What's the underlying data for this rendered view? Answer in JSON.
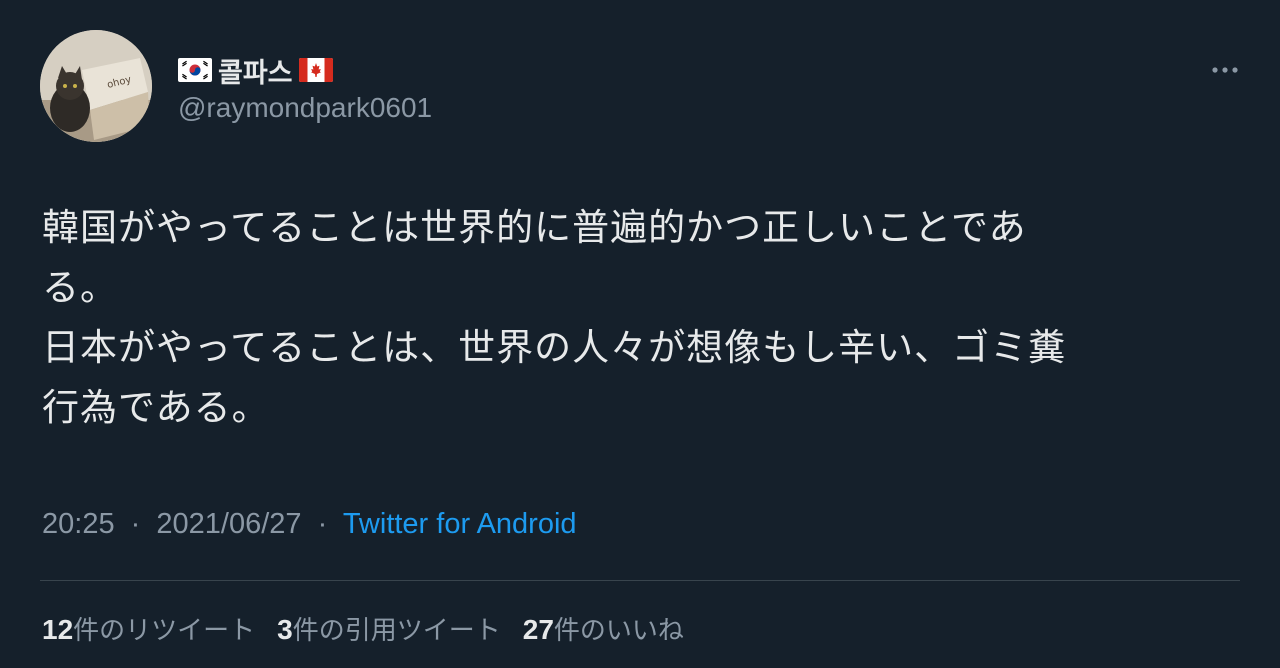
{
  "user": {
    "name": "콜파스",
    "handle": "@raymondpark0601",
    "avatar_icon": "avatar-cat-in-box",
    "flags": [
      "kr-flag-icon",
      "ca-flag-icon"
    ]
  },
  "tweet": {
    "lines": [
      "韓国がやってることは世界的に普遍的かつ正しいことであ",
      "る。",
      "日本がやってることは、世界の人々が想像もし辛い、ゴミ糞",
      "行為である。"
    ],
    "time": "20:25",
    "separator": "·",
    "date": "2021/06/27",
    "source": "Twitter for Android"
  },
  "stats": {
    "retweets_count": "12",
    "retweets_label": "件のリツイート",
    "quotes_count": "3",
    "quotes_label": "件の引用ツイート",
    "likes_count": "27",
    "likes_label": "件のいいね"
  },
  "colors": {
    "background": "#15202b",
    "text": "#e7e9ea",
    "secondary": "#8b98a5",
    "link": "#1d9bf0",
    "divider": "#38444d"
  }
}
